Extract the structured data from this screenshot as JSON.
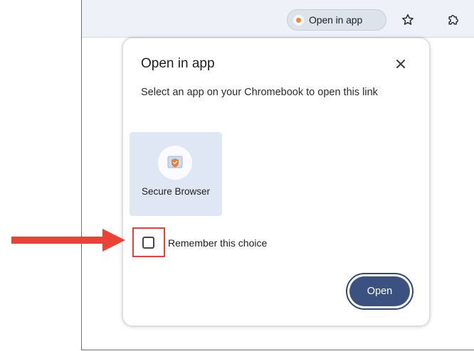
{
  "toolbar": {
    "open_in_app_chip_label": "Open in app"
  },
  "dialog": {
    "title": "Open in app",
    "description": "Select an app on your Chromebook to open this link",
    "apps": [
      {
        "label": "Secure Browser"
      }
    ],
    "remember_label": "Remember this choice",
    "remember_checked": false,
    "open_label": "Open"
  },
  "icons": {
    "chip": "app-dot-icon",
    "bookmark": "star-icon",
    "extensions": "puzzle-icon",
    "close": "close-icon",
    "app": "shield-icon",
    "annotation": "red-arrow"
  },
  "colors": {
    "annotation_red": "#ea4335",
    "primary_button": "#3b5280",
    "app_tile_bg": "#dfe6f4",
    "chip_dot": "#ef8a2f"
  }
}
